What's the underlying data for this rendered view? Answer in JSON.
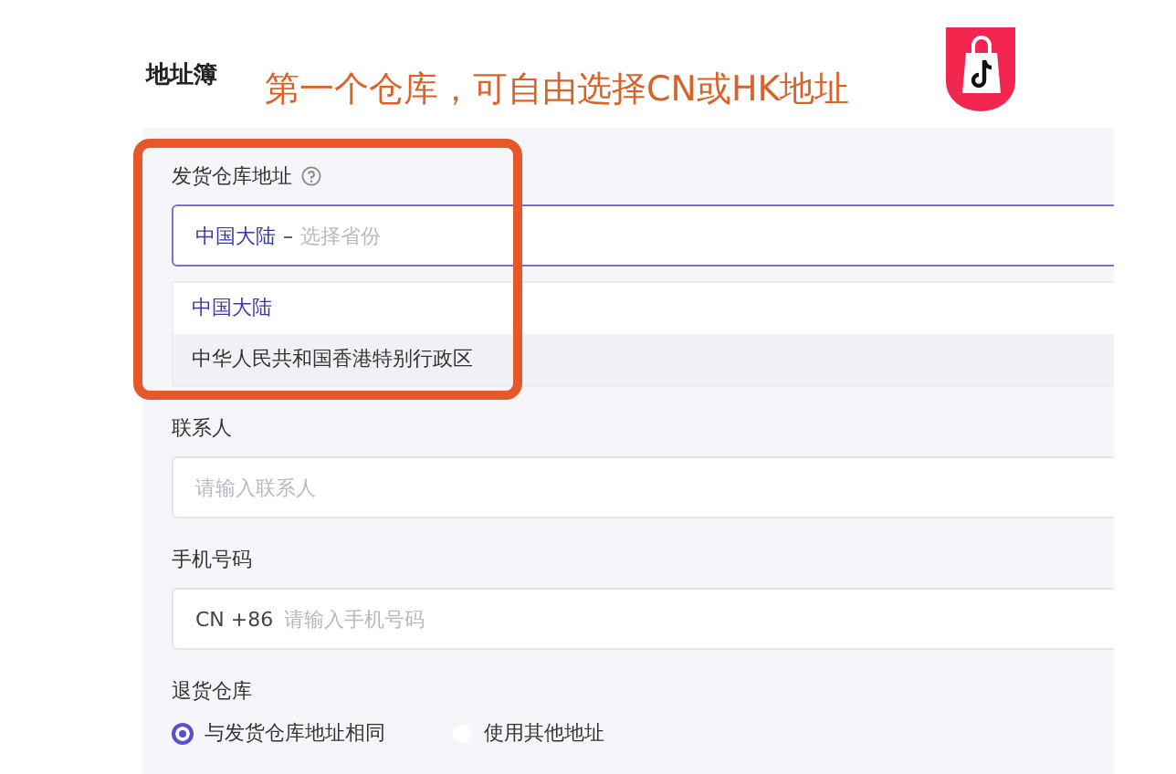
{
  "title": "地址簿",
  "annotation": {
    "text": "第一个仓库，可自由选择CN或HK地址"
  },
  "form": {
    "fields": [
      {
        "kind": "select",
        "label": "发货仓库地址",
        "help": true,
        "value": "中国大陆",
        "separator": "–",
        "placeholder": "选择省份",
        "focused": true,
        "options": [
          {
            "label": "中国大陆",
            "selected": true,
            "highlighted": false
          },
          {
            "label": "中华人民共和国香港特别行政区",
            "selected": false,
            "highlighted": true
          }
        ]
      },
      {
        "kind": "text",
        "label": "联系人",
        "placeholder": "请输入联系人"
      },
      {
        "kind": "phone",
        "label": "手机号码",
        "prefix": "CN +86",
        "placeholder": "请输入手机号码"
      },
      {
        "kind": "radio",
        "label": "退货仓库",
        "options": [
          {
            "label": "与发货仓库地址相同",
            "selected": true
          },
          {
            "label": "使用其他地址",
            "selected": false
          }
        ]
      }
    ]
  }
}
